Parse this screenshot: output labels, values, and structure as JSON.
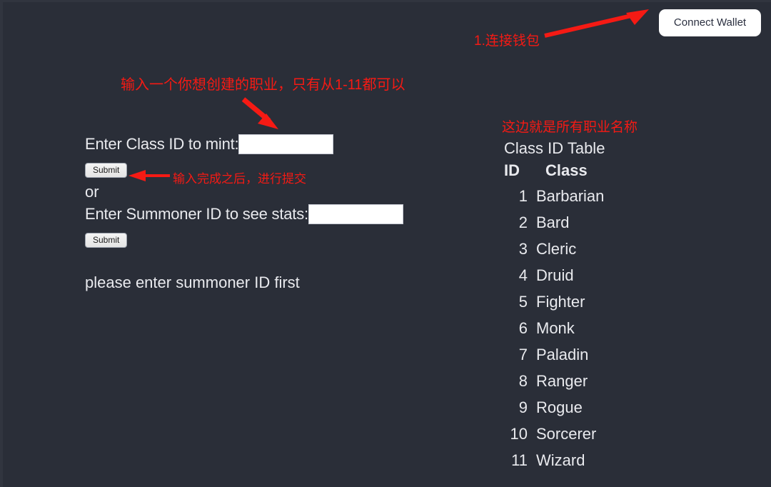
{
  "colors": {
    "background": "#2a2e38",
    "text": "#e9eaee",
    "annotation_red": "#f51a14",
    "button_white": "#ffffff"
  },
  "header": {
    "connect_wallet_label": "Connect Wallet"
  },
  "form": {
    "class_id_label": "Enter Class ID to mint:",
    "class_id_value": "",
    "class_id_placeholder": "",
    "submit_class_label": "Submit",
    "or_label": "or",
    "summoner_id_label": "Enter Summoner ID to see stats:",
    "summoner_id_value": "",
    "summoner_id_placeholder": "",
    "submit_summoner_label": "Submit",
    "status_message": "please enter summoner ID first"
  },
  "class_table": {
    "title": "Class ID Table",
    "columns": {
      "id": "ID",
      "class": "Class"
    },
    "rows": [
      {
        "id": "1",
        "class": "Barbarian"
      },
      {
        "id": "2",
        "class": "Bard"
      },
      {
        "id": "3",
        "class": "Cleric"
      },
      {
        "id": "4",
        "class": "Druid"
      },
      {
        "id": "5",
        "class": "Fighter"
      },
      {
        "id": "6",
        "class": "Monk"
      },
      {
        "id": "7",
        "class": "Paladin"
      },
      {
        "id": "8",
        "class": "Ranger"
      },
      {
        "id": "9",
        "class": "Rogue"
      },
      {
        "id": "10",
        "class": "Sorcerer"
      },
      {
        "id": "11",
        "class": "Wizard"
      }
    ]
  },
  "annotations": {
    "connect_wallet": "1.连接钱包",
    "class_input": "输入一个你想创建的职业，只有从1-11都可以",
    "submit_hint": "输入完成之后，进行提交",
    "class_table": "这边就是所有职业名称"
  }
}
